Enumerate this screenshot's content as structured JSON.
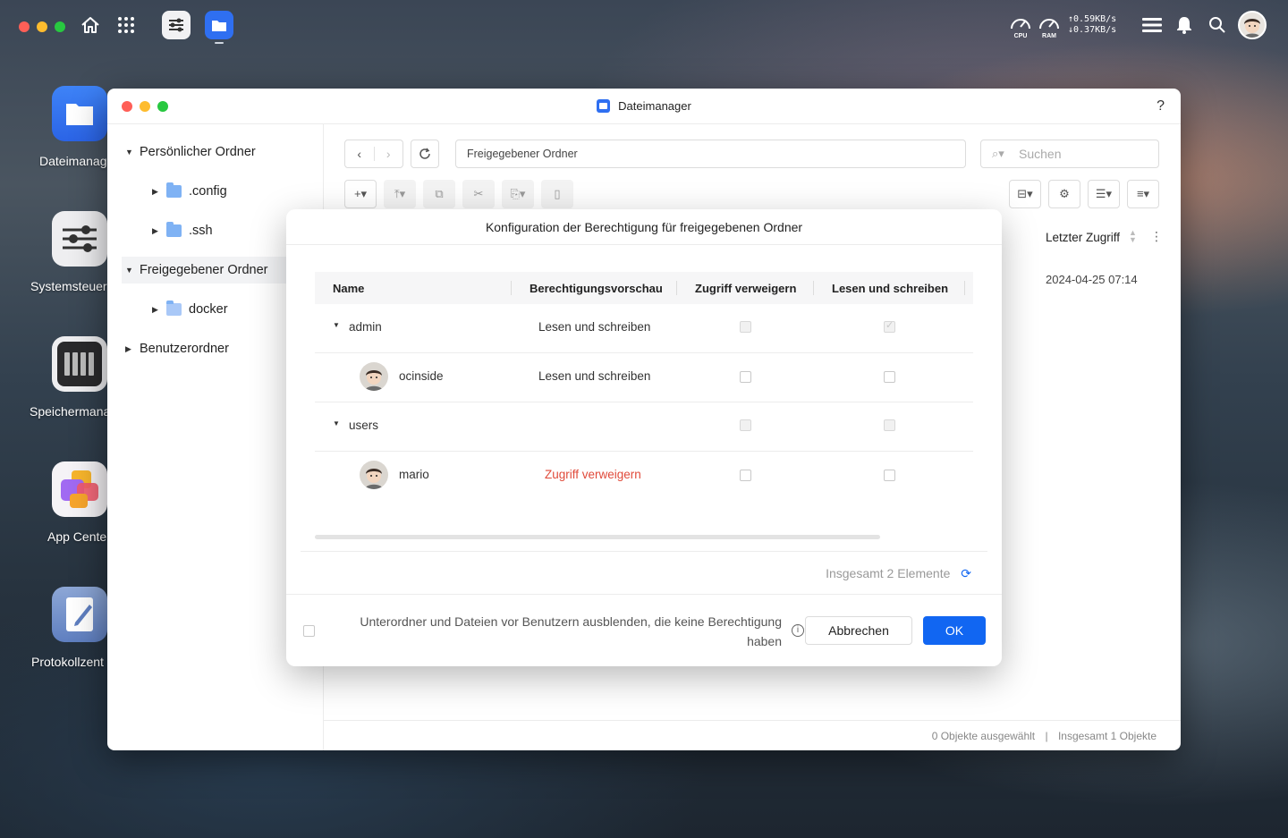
{
  "desktop": {
    "icons": [
      {
        "label": "Dateimanag",
        "name": "dateimanager"
      },
      {
        "label": "Systemsteuer",
        "name": "systemsteuerung"
      },
      {
        "label": "Speichermana",
        "name": "speichermanager"
      },
      {
        "label": "App Cente",
        "name": "app-center"
      },
      {
        "label": "Protokollzent",
        "name": "protokollzentrum"
      }
    ]
  },
  "topbar": {
    "cpu_label": "CPU",
    "ram_label": "RAM",
    "upload": "↑0.59KB/s",
    "download": "↓0.37KB/s"
  },
  "window": {
    "title": "Dateimanager",
    "help": "?",
    "sidebar": {
      "personal": "Persönlicher Ordner",
      "config": ".config",
      "ssh": ".ssh",
      "shared": "Freigegebener Ordner",
      "docker": "docker",
      "users": "Benutzerordner"
    },
    "path": "Freigegebener Ordner",
    "search_placeholder": "Suchen",
    "columns": {
      "last_access": "Letzter Zugriff"
    },
    "row_last_access": "2024-04-25 07:14",
    "status_selected": "0 Objekte ausgewählt",
    "status_sep": "|",
    "status_total": "Insgesamt 1 Objekte"
  },
  "dialog": {
    "title": "Konfiguration der Berechtigung für freigegebenen Ordner",
    "headers": {
      "name": "Name",
      "preview": "Berechtigungsvorschau",
      "deny": "Zugriff verweigern",
      "rw": "Lesen und schreiben"
    },
    "rows": [
      {
        "name": "admin",
        "preview": "Lesen und schreiben"
      },
      {
        "name": "ocinside",
        "preview": "Lesen und schreiben"
      },
      {
        "name": "users",
        "preview": ""
      },
      {
        "name": "mario",
        "preview": "Zugriff verweigern"
      }
    ],
    "total": "Insgesamt 2 Elemente",
    "hide_option": "Unterordner und Dateien vor Benutzern ausblenden, die keine Berechtigung haben",
    "cancel": "Abbrechen",
    "ok": "OK",
    "accent": "#1166f2",
    "deny_color": "#e04a3a"
  }
}
